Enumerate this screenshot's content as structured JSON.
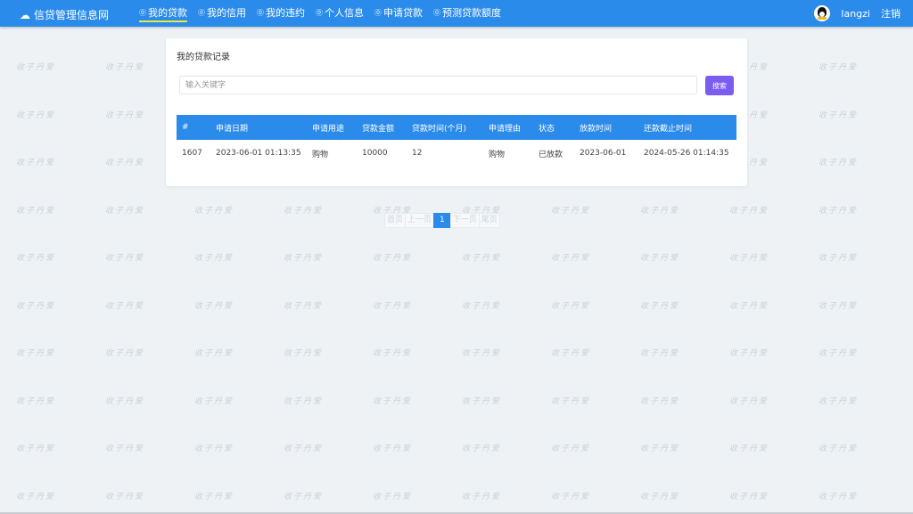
{
  "nav": {
    "brand": "信贷管理信息网",
    "items": [
      {
        "label": "我的贷款"
      },
      {
        "label": "我的信用"
      },
      {
        "label": "我的违约"
      },
      {
        "label": "个人信息"
      },
      {
        "label": "申请贷款"
      },
      {
        "label": "预测贷款额度"
      }
    ],
    "username": "langzi",
    "logout": "注销"
  },
  "card": {
    "title": "我的贷款记录",
    "search_placeholder": "输入关键字",
    "search_button": "搜索"
  },
  "table": {
    "headers": [
      "#",
      "申请日期",
      "申请用途",
      "贷款金额",
      "贷款时间(个月)",
      "申请理由",
      "状态",
      "放款时间",
      "还款截止时间"
    ],
    "rows": [
      [
        "1607",
        "2023-06-01 01:13:35",
        "购物",
        "10000",
        "12",
        "购物",
        "已放款",
        "2023-06-01",
        "2024-05-26 01:14:35"
      ]
    ]
  },
  "pagination": {
    "first": "首页",
    "prev": "上一页",
    "current": "1",
    "next": "下一页",
    "last": "尾页"
  },
  "watermark": "收子丹爱",
  "colors": {
    "nav_bg": "#2a8bea",
    "active_underline": "#f0e640",
    "search_btn": "#7b5cf0",
    "table_header": "#2a8bea"
  }
}
